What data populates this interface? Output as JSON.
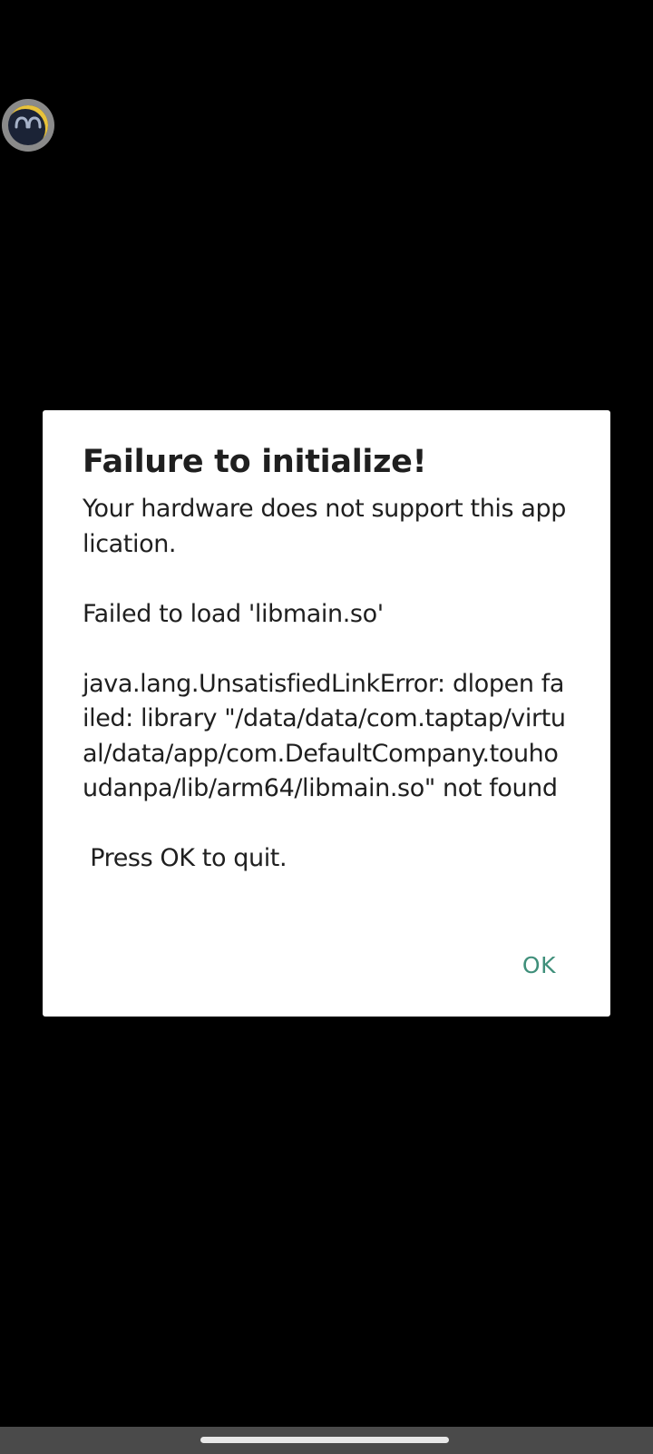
{
  "floating_ball": {
    "icon": "assistant-face-icon"
  },
  "dialog": {
    "title": "Failure to initialize!",
    "message": "Your hardware does not support this application.\n\nFailed to load 'libmain.so'\n\njava.lang.UnsatisfiedLinkError: dlopen failed: library \"/data/data/com.taptap/virtual/data/app/com.DefaultCompany.touhoudanpa/lib/arm64/libmain.so\" not found\n\n Press OK to quit.",
    "ok_label": "OK"
  },
  "colors": {
    "background": "#000000",
    "dialog_background": "#ffffff",
    "accent": "#3f8f7a",
    "text": "#1f1f1f"
  }
}
